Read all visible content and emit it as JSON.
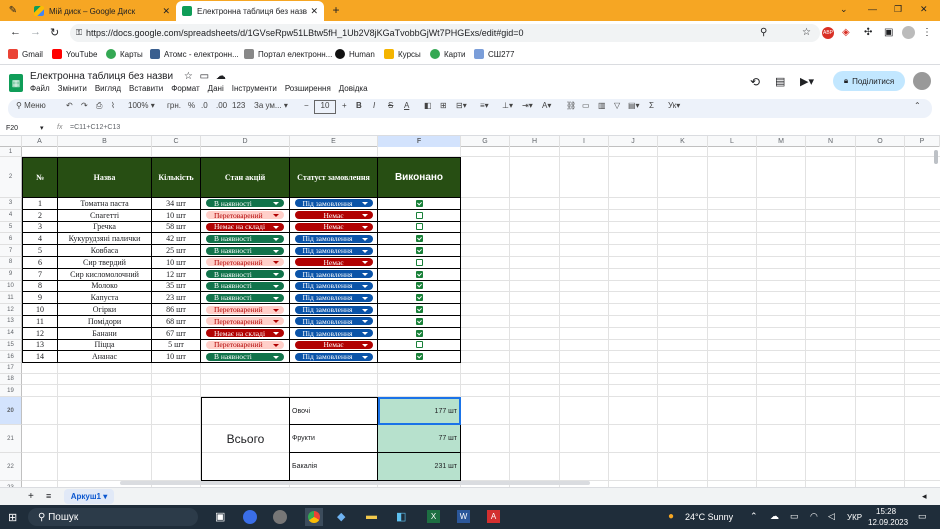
{
  "browser": {
    "tabs": [
      {
        "title": "Мій диск – Google Диск"
      },
      {
        "title": "Електронна таблиця без назв"
      }
    ],
    "url": "https://docs.google.com/spreadsheets/d/1GVseRpw51LBtw5fH_1Ub2V8jKGaTvobbGjWt7PHGExs/edit#gid=0",
    "bookmarks": [
      "Gmail",
      "YouTube",
      "Карты",
      "Атомс - електронн...",
      "Портал електронн...",
      "Human",
      "Курсы",
      "Карти",
      "СШ277"
    ]
  },
  "doc": {
    "title": "Електронна таблиця без назви",
    "menus": [
      "Файл",
      "Змінити",
      "Вигляд",
      "Вставити",
      "Формат",
      "Дані",
      "Інструменти",
      "Розширення",
      "Довідка"
    ],
    "share_label": "Поділитися"
  },
  "toolbar": {
    "menu_label": "Меню",
    "zoom": "100%",
    "currency": "грн.",
    "percent": "%",
    "dec_dec": ".0",
    "dec_inc": ".00",
    "num_format": "123",
    "font": "За ум...",
    "font_size": "10"
  },
  "formula_bar": {
    "cell_ref": "F20",
    "fx": "fx",
    "formula": "=C11+C12+C13"
  },
  "columns": [
    "A",
    "B",
    "C",
    "D",
    "E",
    "F",
    "G",
    "H",
    "I",
    "J",
    "K",
    "L",
    "M",
    "N",
    "O",
    "P"
  ],
  "table": {
    "headers": [
      "№",
      "Назва",
      "Кількість",
      "Стан акцій",
      "Статуст замовлення",
      "Виконано"
    ],
    "rows": [
      {
        "n": "1",
        "name": "Томатна паста",
        "qty": "34 шт",
        "stock": "В наявності",
        "order": "Під замовлення",
        "done": true
      },
      {
        "n": "2",
        "name": "Спагетті",
        "qty": "10 шт",
        "stock": "Перетоварений",
        "order": "Немає",
        "done": false
      },
      {
        "n": "3",
        "name": "Гречка",
        "qty": "58 шт",
        "stock": "Немає на складі",
        "order": "Немає",
        "done": false
      },
      {
        "n": "4",
        "name": "Кукурудзяні палички",
        "qty": "42 шт",
        "stock": "В наявності",
        "order": "Під замовлення",
        "done": true
      },
      {
        "n": "5",
        "name": "Ковбаса",
        "qty": "25 шт",
        "stock": "В наявності",
        "order": "Під замовлення",
        "done": true
      },
      {
        "n": "6",
        "name": "Сир твердий",
        "qty": "10 шт",
        "stock": "Перетоварений",
        "order": "Немає",
        "done": false
      },
      {
        "n": "7",
        "name": "Сир кисломолочний",
        "qty": "12 шт",
        "stock": "В наявності",
        "order": "Під замовлення",
        "done": true
      },
      {
        "n": "8",
        "name": "Молоко",
        "qty": "35 шт",
        "stock": "В наявності",
        "order": "Під замовлення",
        "done": true
      },
      {
        "n": "9",
        "name": "Капуста",
        "qty": "23 шт",
        "stock": "В наявності",
        "order": "Під замовлення",
        "done": true
      },
      {
        "n": "10",
        "name": "Огірки",
        "qty": "86 шт",
        "stock": "Перетоварений",
        "order": "Під замовлення",
        "done": true
      },
      {
        "n": "11",
        "name": "Помідори",
        "qty": "68 шт",
        "stock": "Перетоварений",
        "order": "Під замовлення",
        "done": true
      },
      {
        "n": "12",
        "name": "Банани",
        "qty": "67 шт",
        "stock": "Немає на складі",
        "order": "Під замовлення",
        "done": true
      },
      {
        "n": "13",
        "name": "Піцца",
        "qty": "5 шт",
        "stock": "Перетоварений",
        "order": "Немає",
        "done": false
      },
      {
        "n": "14",
        "name": "Ананас",
        "qty": "10 шт",
        "stock": "В наявності",
        "order": "Під замовлення",
        "done": true
      }
    ]
  },
  "summary": {
    "label": "Всього",
    "items": [
      {
        "label": "Овочі",
        "value": "177 шт"
      },
      {
        "label": "Фрукти",
        "value": "77 шт"
      },
      {
        "label": "Бакалія",
        "value": "231 шт"
      }
    ]
  },
  "sheet_tab": "Аркуш1",
  "taskbar": {
    "search": "Пошук",
    "weather": "24°C  Sunny",
    "lang": "УКР",
    "time": "15:28",
    "date": "12.09.2023"
  },
  "colors": {
    "in_stock": "#11734b",
    "overstock_bg": "#ffcfc9",
    "overstock_fg": "#b10202",
    "out_stock": "#b10202",
    "order": "#0a53a8",
    "header_bg": "#274e13",
    "summary_bg": "#b7e1cd"
  }
}
